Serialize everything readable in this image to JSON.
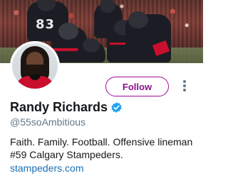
{
  "profile": {
    "display_name": "Randy Richards",
    "verified": true,
    "handle": "@55soAmbitious",
    "bio": "Faith. Family. Football. Offensive lineman #59 Calgary Stampeders.",
    "website": "stampeders.com"
  },
  "banner": {
    "jersey_numbers": [
      "83"
    ]
  },
  "actions": {
    "follow_label": "Follow",
    "more_icon": "vertical-ellipsis-icon"
  },
  "colors": {
    "follow_accent": "#a10aa0",
    "link": "#1b6fb3",
    "verified": "#1da1f2",
    "secondary_text": "#657786"
  }
}
